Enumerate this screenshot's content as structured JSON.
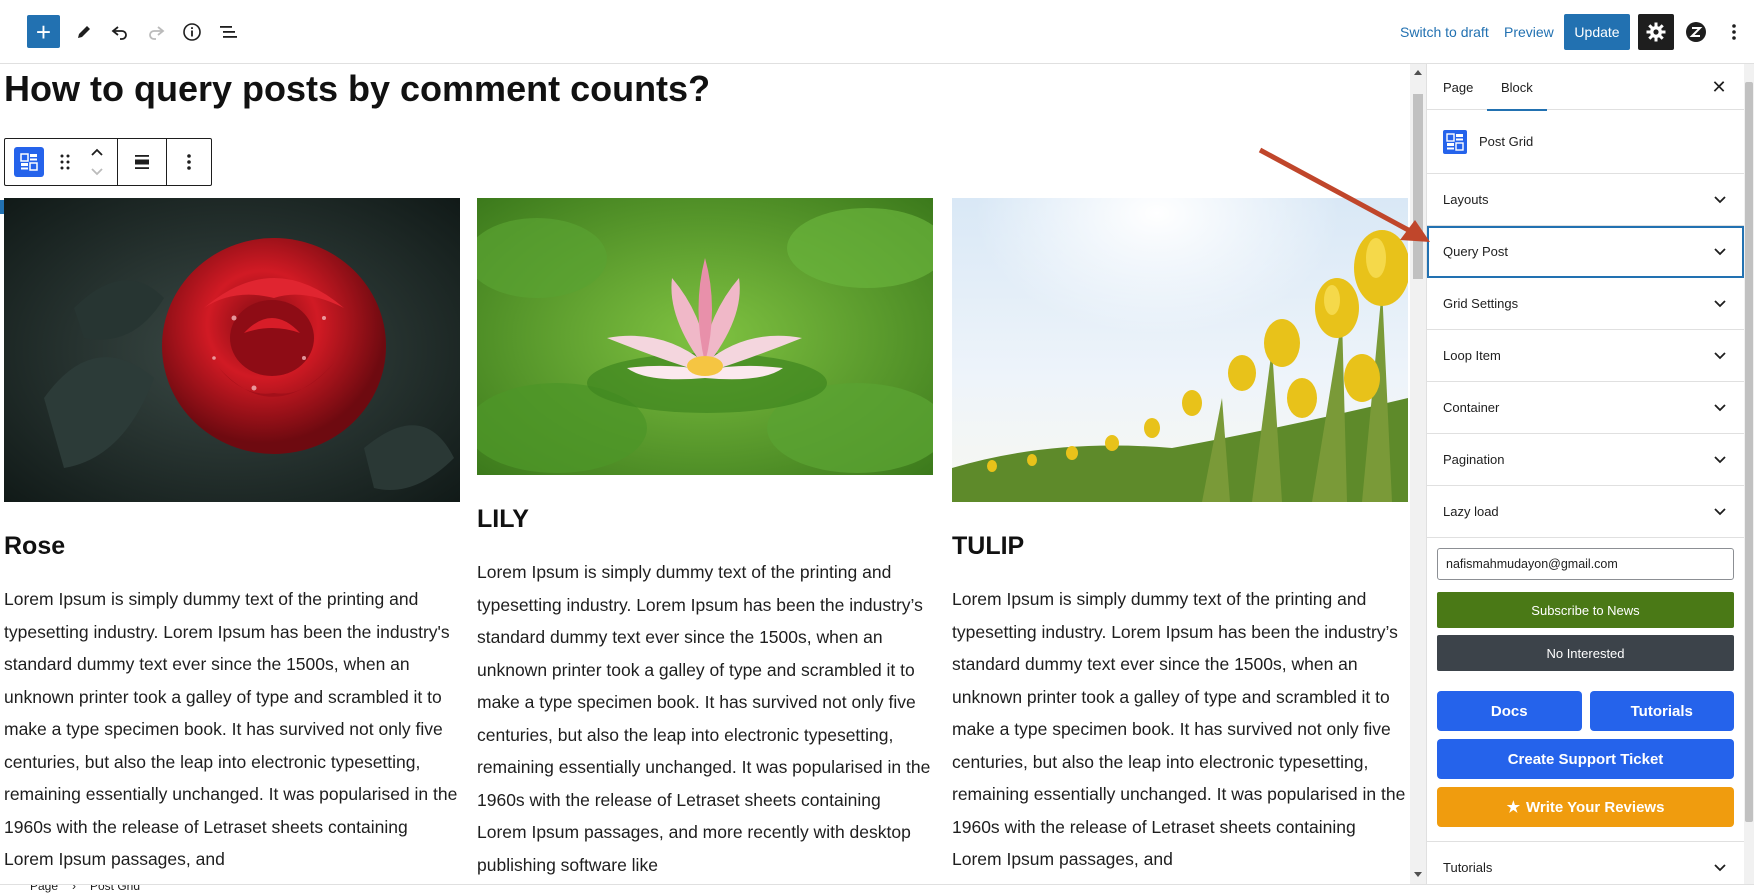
{
  "topbar": {
    "add_label": "+",
    "switch_to_draft": "Switch to draft",
    "preview": "Preview",
    "update": "Update",
    "icons": [
      "plus-icon",
      "pencil-icon",
      "undo-icon",
      "redo-icon",
      "info-icon",
      "list-view-icon",
      "gear-icon",
      "zendesk-icon",
      "more-vertical-icon"
    ]
  },
  "post": {
    "title": "How to query posts by comment counts?",
    "cards": [
      {
        "title": "Rose",
        "excerpt": "Lorem Ipsum is simply dummy text of the printing and typesetting industry. Lorem Ipsum has been the industry's standard dummy text ever since the 1500s, when an unknown printer took a galley of type and scrambled it to make a type specimen book. It has survived not only five centuries, but also the leap into electronic typesetting, remaining essentially unchanged. It was popularised in the 1960s with the release of Letraset sheets containing Lorem Ipsum passages, and"
      },
      {
        "title": "LILY",
        "excerpt": "Lorem Ipsum is simply dummy text of the printing and typesetting industry. Lorem Ipsum has been the industry’s standard dummy text ever since the 1500s, when an unknown printer took a galley of type and scrambled it to make a type specimen book. It has survived not only five centuries, but also the leap into electronic typesetting, remaining essentially unchanged. It was popularised in the 1960s with the release of Letraset sheets containing Lorem Ipsum passages, and more recently with desktop publishing software like"
      },
      {
        "title": "TULIP",
        "excerpt": "Lorem Ipsum is simply dummy text of the printing and typesetting industry. Lorem Ipsum has been the industry’s standard dummy text ever since the 1500s, when an unknown printer took a galley of type and scrambled it to make a type specimen book. It has survived not only five centuries, but also the leap into electronic typesetting, remaining essentially unchanged. It was popularised in the 1960s with the release of Letraset sheets containing Lorem Ipsum passages, and"
      }
    ]
  },
  "sidebar": {
    "tabs": {
      "page": "Page",
      "block": "Block"
    },
    "block_name": "Post Grid",
    "panels": [
      "Layouts",
      "Query Post",
      "Grid Settings",
      "Loop Item",
      "Container",
      "Pagination",
      "Lazy load"
    ],
    "email_value": "nafismahmudayon@gmail.com",
    "subscribe": "Subscribe to News",
    "not_interested": "No Interested",
    "docs": "Docs",
    "tutorials_btn": "Tutorials",
    "support": "Create Support Ticket",
    "reviews": "Write Your Reviews",
    "last_panel": "Tutorials"
  },
  "footer": {
    "crumb_page": "Page",
    "crumb_block": "Post Grid"
  },
  "colors": {
    "accent": "#2271b1",
    "subscribe": "#4a7916",
    "no_interest": "#3c434a",
    "blue_buttons": "#2563eb",
    "review": "#f09c0e",
    "annotation_arrow": "#c0462b"
  }
}
